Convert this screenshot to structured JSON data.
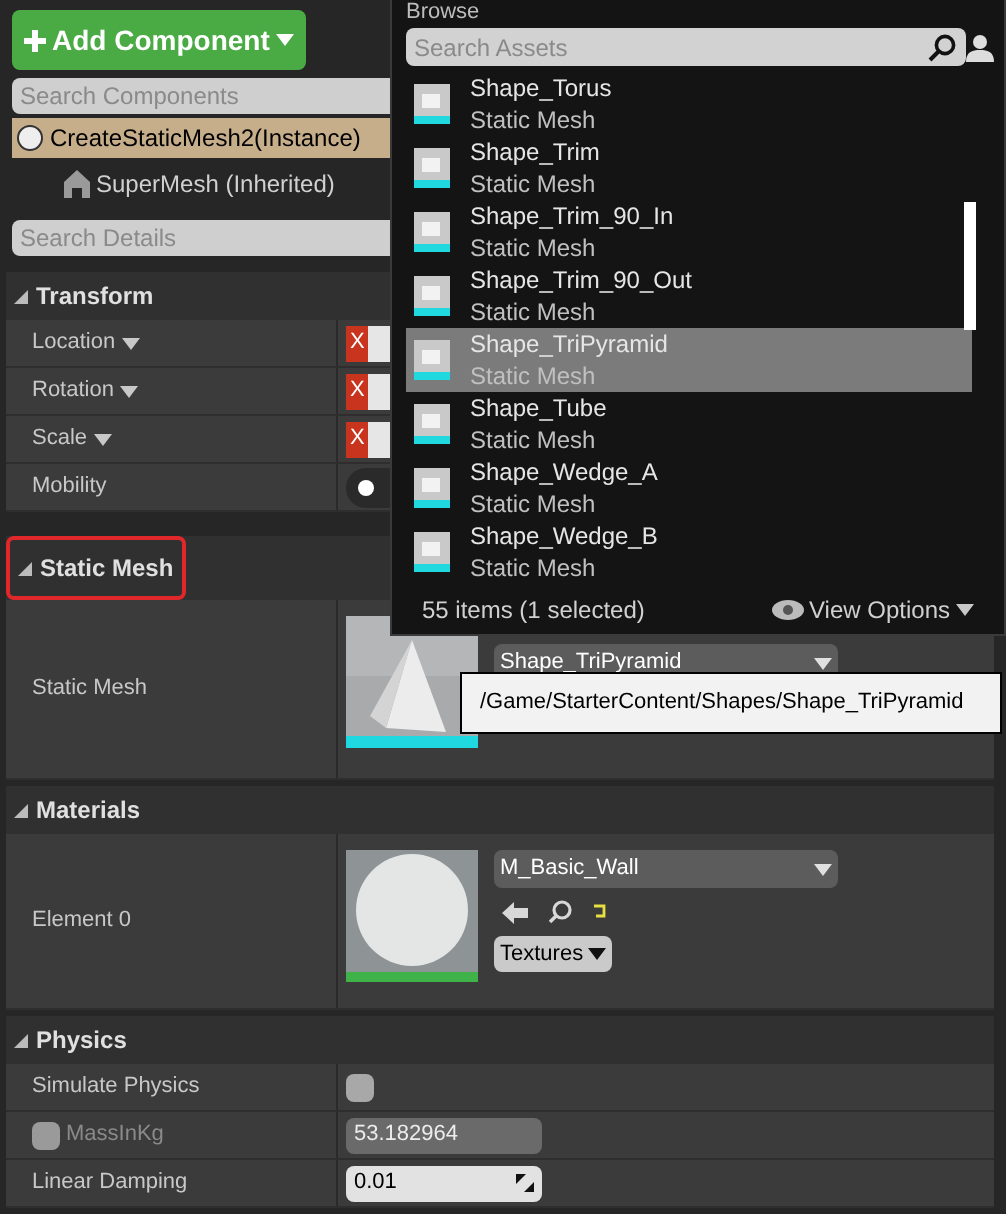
{
  "add_button": {
    "label": "Add Component"
  },
  "component_search": {
    "placeholder": "Search Components"
  },
  "components": [
    {
      "label": "CreateStaticMesh2(Instance)",
      "selected": true,
      "children": [
        {
          "label": "SuperMesh (Inherited)",
          "selected": false
        }
      ]
    }
  ],
  "details_search": {
    "placeholder": "Search Details"
  },
  "sections": [
    {
      "title": "Transform",
      "highlighted": false,
      "expanded": true,
      "rows": [
        {
          "kind": "vector",
          "label": "Location",
          "axis": "X"
        },
        {
          "kind": "vector",
          "label": "Rotation",
          "axis": "X"
        },
        {
          "kind": "vector",
          "label": "Scale",
          "axis": "X"
        },
        {
          "kind": "radio",
          "label": "Mobility"
        }
      ]
    },
    {
      "title": "Static Mesh",
      "highlighted": true,
      "expanded": true,
      "rows": [
        {
          "kind": "mesh",
          "label": "Static Mesh",
          "value": "Shape_TriPyramid"
        }
      ]
    },
    {
      "title": "Materials",
      "highlighted": false,
      "expanded": true,
      "rows": [
        {
          "kind": "material",
          "label": "Element 0",
          "value": "M_Basic_Wall",
          "menu": "Textures"
        }
      ]
    },
    {
      "title": "Physics",
      "highlighted": false,
      "expanded": true,
      "rows": [
        {
          "kind": "checkbox",
          "label": "Simulate Physics",
          "checked": false
        },
        {
          "kind": "number",
          "label": "MassInKg",
          "value": "53.182964",
          "disabled": true,
          "checked": false
        },
        {
          "kind": "number",
          "label": "Linear Damping",
          "value": "0.01",
          "disabled": false
        }
      ]
    }
  ],
  "asset_picker": {
    "title": "Browse",
    "search": {
      "placeholder": "Search Assets"
    },
    "items": [
      {
        "name": "Shape_Torus",
        "type": "Static Mesh",
        "selected": false
      },
      {
        "name": "Shape_Trim",
        "type": "Static Mesh",
        "selected": false
      },
      {
        "name": "Shape_Trim_90_In",
        "type": "Static Mesh",
        "selected": false
      },
      {
        "name": "Shape_Trim_90_Out",
        "type": "Static Mesh",
        "selected": false
      },
      {
        "name": "Shape_TriPyramid",
        "type": "Static Mesh",
        "selected": true
      },
      {
        "name": "Shape_Tube",
        "type": "Static Mesh",
        "selected": false
      },
      {
        "name": "Shape_Wedge_A",
        "type": "Static Mesh",
        "selected": false
      },
      {
        "name": "Shape_Wedge_B",
        "type": "Static Mesh",
        "selected": false
      }
    ],
    "status": "55 items (1 selected)",
    "view_options": "View Options"
  },
  "tooltip": "/Game/StarterContent/Shapes/Shape_TriPyramid"
}
